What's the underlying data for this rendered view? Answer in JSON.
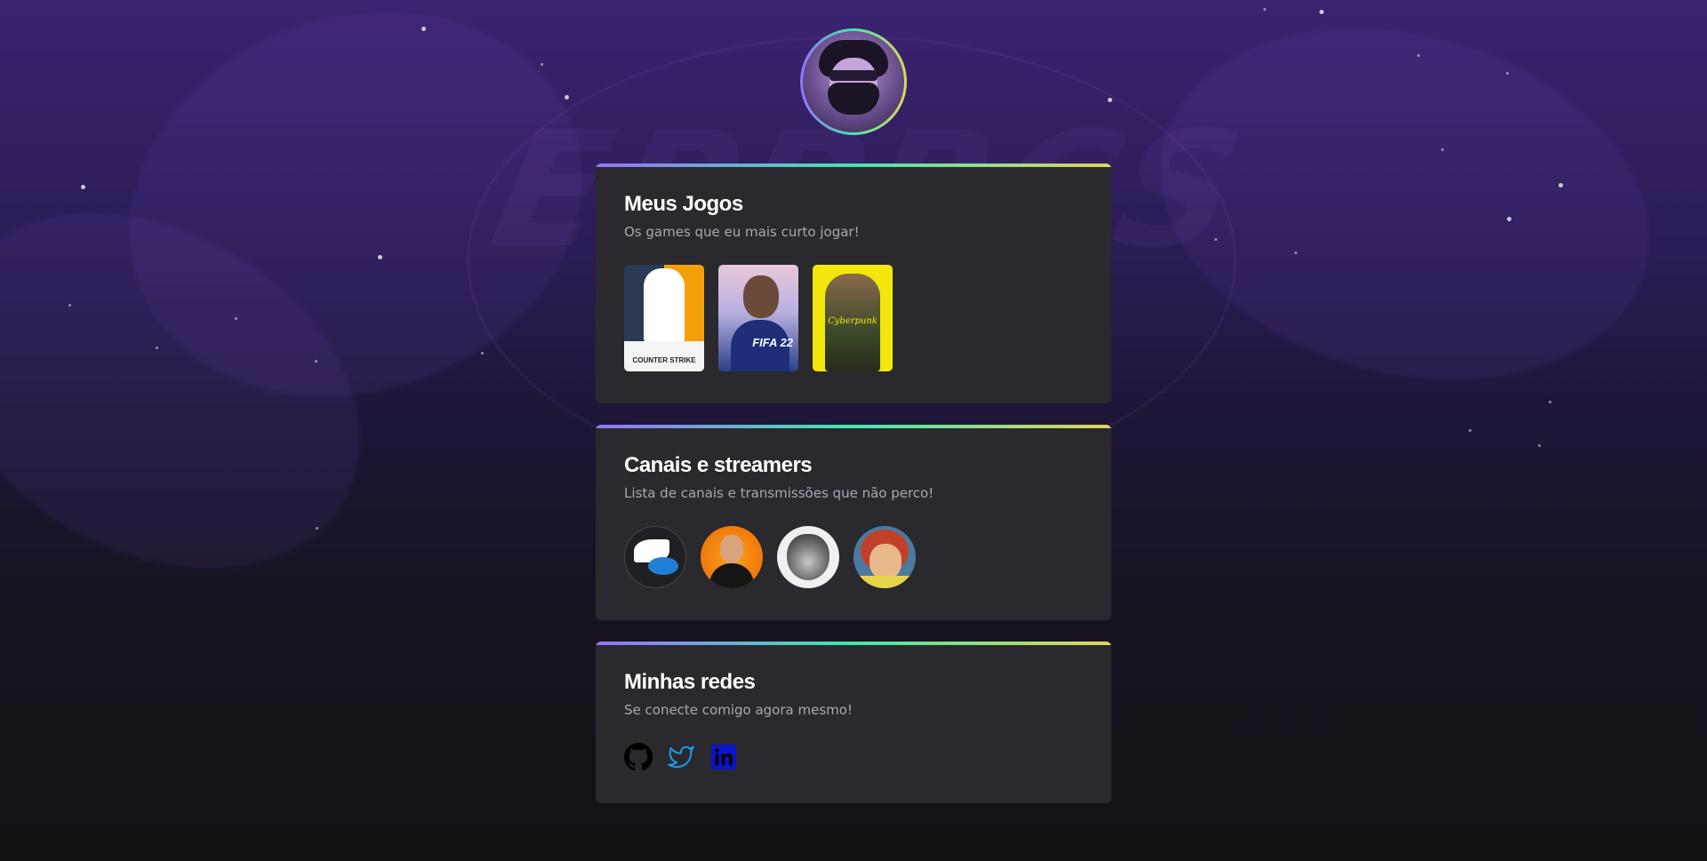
{
  "profile": {
    "avatar_icon": "user-avatar"
  },
  "games_card": {
    "title": "Meus Jogos",
    "subtitle": "Os games que eu mais curto jogar!",
    "games": [
      {
        "name": "Counter Strike",
        "logo_text": "COUNTER STRIKE"
      },
      {
        "name": "FIFA 22",
        "logo_text": "FIFA 22"
      },
      {
        "name": "Cyberpunk",
        "logo_text": "Cyberpunk"
      }
    ]
  },
  "streamers_card": {
    "title": "Canais e streamers",
    "subtitle": "Lista de canais e transmissões que não perco!"
  },
  "networks_card": {
    "title": "Minhas redes",
    "subtitle": "Se conecte comigo agora mesmo!",
    "icons": [
      "github-icon",
      "twitter-icon",
      "linkedin-icon"
    ]
  },
  "colors": {
    "accent_gradient": [
      "#9572FC",
      "#43E7AD",
      "#E2D45C"
    ],
    "card_bg": "#29292E",
    "github": "#000000",
    "twitter": "#1D9BF0",
    "linkedin": "#0A14C8"
  }
}
